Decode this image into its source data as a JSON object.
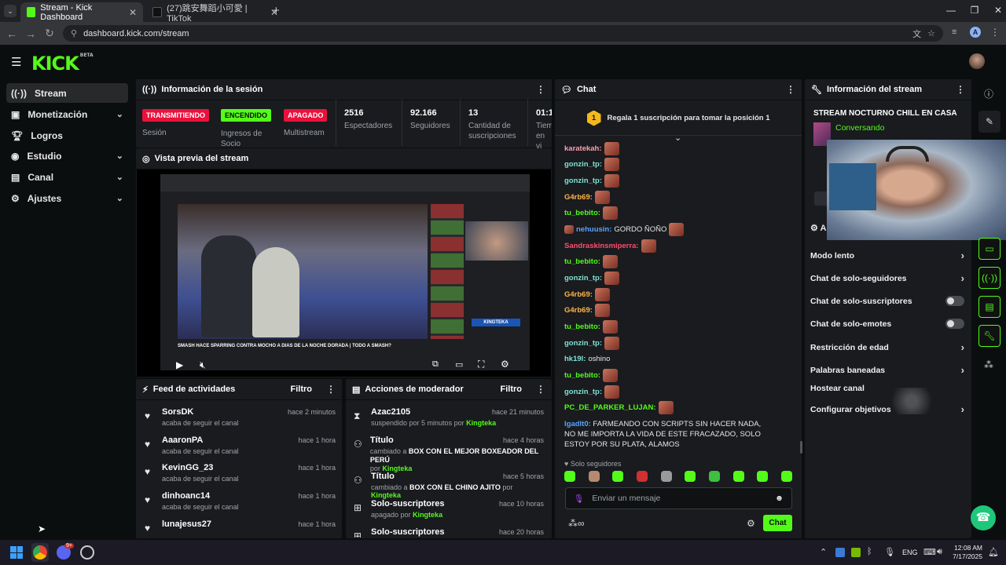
{
  "browser": {
    "tabs": [
      {
        "title": "Stream - Kick Dashboard",
        "active": true
      },
      {
        "title": "(27)跳安舞蹈小可愛 | TikTok",
        "active": false
      }
    ],
    "url": "dashboard.kick.com/stream",
    "profile_initial": "A"
  },
  "app": {
    "logo": "KICK",
    "logo_tag": "BETA"
  },
  "sidebar": {
    "items": [
      {
        "label": "Stream",
        "icon": "stream-icon"
      },
      {
        "label": "Monetización",
        "icon": "money-icon"
      },
      {
        "label": "Logros",
        "icon": "trophy-icon"
      },
      {
        "label": "Estudio",
        "icon": "studio-icon"
      },
      {
        "label": "Canal",
        "icon": "channel-icon"
      },
      {
        "label": "Ajustes",
        "icon": "gear-icon"
      }
    ]
  },
  "session": {
    "title": "Información de la sesión",
    "badges": [
      {
        "label": "TRANSMITIENDO",
        "caption": "Sesión",
        "color": "#e9113c"
      },
      {
        "label": "ENCENDIDO",
        "caption": "Ingresos de Socio",
        "color": "#53fc18"
      },
      {
        "label": "APAGADO",
        "caption": "Multistream",
        "color": "#e9113c"
      }
    ],
    "stats": [
      {
        "value": "2516",
        "label": "Espectadores"
      },
      {
        "value": "92.166",
        "label": "Seguidores"
      },
      {
        "value": "13",
        "label": "Cantidad de suscripciones"
      },
      {
        "value": "01:1",
        "label": "Tiem en vi"
      }
    ]
  },
  "preview": {
    "title": "Vista previa del stream",
    "video_caption": "SMASH HACE SPARRING CONTRA MOCHO A DIAS DE LA NOCHE DORADA | TODO A SMASH?",
    "overlay_name": "KINGTEKA"
  },
  "activity": {
    "title": "Feed de actividades",
    "filter": "Filtro",
    "items": [
      {
        "name": "SorsDK",
        "action": "acaba de seguir el canal",
        "time": "hace 2 minutos"
      },
      {
        "name": "AaaronPA",
        "action": "acaba de seguir el canal",
        "time": "hace 1 hora"
      },
      {
        "name": "KevinGG_23",
        "action": "acaba de seguir el canal",
        "time": "hace 1 hora"
      },
      {
        "name": "dinhoanc14",
        "action": "acaba de seguir el canal",
        "time": "hace 1 hora"
      },
      {
        "name": "lunajesus27",
        "action": "",
        "time": "hace 1 hora"
      }
    ]
  },
  "modactions": {
    "title": "Acciones de moderador",
    "filter": "Filtro",
    "items": [
      {
        "name": "Azac2105",
        "pre": "suspendido por 5 minutos por",
        "target": "",
        "by": "Kingteka",
        "time": "hace 21 minutos",
        "icon": "hourglass-icon"
      },
      {
        "name": "Título",
        "pre": "cambiado a",
        "target": "BOX CON EL MEJOR BOXEADOR DEL PERÚ",
        "by": "Kingteka",
        "time": "hace 4 horas",
        "icon": "title-icon"
      },
      {
        "name": "Título",
        "pre": "cambiado a",
        "target": "BOX CON EL CHINO AJITO",
        "by": "Kingteka",
        "time": "hace 5 horas",
        "icon": "title-icon"
      },
      {
        "name": "Solo-suscriptores",
        "pre": "apagado por",
        "target": "",
        "by": "Kingteka",
        "time": "hace 10 horas",
        "icon": "gift-icon"
      },
      {
        "name": "Solo-suscriptores",
        "pre": "",
        "target": "",
        "by": "",
        "time": "hace 20 horas",
        "icon": "gift-icon"
      }
    ]
  },
  "chat": {
    "title": "Chat",
    "gift_position": "1",
    "gift_text": "Regala 1 suscripción para tomar la posición 1",
    "messages": [
      {
        "user": "karatekah:",
        "color": "#ff9fb0",
        "text": "",
        "emote": true
      },
      {
        "user": "gonzin_tp:",
        "color": "#7fe3d4",
        "text": "",
        "emote": true
      },
      {
        "user": "gonzin_tp:",
        "color": "#7fe3d4",
        "text": "",
        "emote": true
      },
      {
        "user": "G4rb69:",
        "color": "#ffb347",
        "text": "",
        "emote": true
      },
      {
        "user": "tu_bebito:",
        "color": "#53fc18",
        "text": "",
        "emote": true
      },
      {
        "user": "nehuusin:",
        "color": "#5aa2ff",
        "text": "GORDO ÑOÑO",
        "emote": true
      },
      {
        "user": "Sandraskinsmiperra:",
        "color": "#ff4d6d",
        "text": "",
        "emote": true
      },
      {
        "user": "tu_bebito:",
        "color": "#53fc18",
        "text": "",
        "emote": true
      },
      {
        "user": "gonzin_tp:",
        "color": "#7fe3d4",
        "text": "",
        "emote": true
      },
      {
        "user": "G4rb69:",
        "color": "#ffb347",
        "text": "",
        "emote": true
      },
      {
        "user": "G4rb69:",
        "color": "#ffb347",
        "text": "",
        "emote": true
      },
      {
        "user": "tu_bebito:",
        "color": "#53fc18",
        "text": "",
        "emote": true
      },
      {
        "user": "gonzin_tp:",
        "color": "#7fe3d4",
        "text": "",
        "emote": true
      },
      {
        "user": "hk19l:",
        "color": "#7fe3d4",
        "text": "oshino",
        "emote": false
      },
      {
        "user": "tu_bebito:",
        "color": "#53fc18",
        "text": "",
        "emote": true
      },
      {
        "user": "gonzin_tp:",
        "color": "#7fe3d4",
        "text": "",
        "emote": true
      },
      {
        "user": "PC_DE_PARKER_LUJAN:",
        "color": "#53fc18",
        "text": "",
        "emote": true
      }
    ],
    "long_message": {
      "user": "lgadlt0:",
      "color": "#5aa2ff",
      "text": "FARMEANDO CON SCRIPTS SIN HACER NADA, NO ME IMPORTA LA VIDA DE ESTE FRACAZADO, SOLO ESTOY POR SU PLATA, ALAMOS"
    },
    "mode_label": "Solo seguidores",
    "input_placeholder": "Enviar un mensaje",
    "send_label": "Chat"
  },
  "streaminfo": {
    "title": "Información del stream",
    "stream_title": "STREAM NOCTURNO CHILL EN CASA",
    "category": "Conversando",
    "settings_header": "A",
    "settings": [
      {
        "label": "Modo lento",
        "control": "arrow"
      },
      {
        "label": "Chat de solo-seguidores",
        "control": "arrow"
      },
      {
        "label": "Chat de solo-suscriptores",
        "control": "toggle"
      },
      {
        "label": "Chat de solo-emotes",
        "control": "toggle"
      },
      {
        "label": "Restricción de edad",
        "control": "arrow"
      },
      {
        "label": "Palabras baneadas",
        "control": "arrow"
      },
      {
        "label": "Hostear canal",
        "control": "none"
      },
      {
        "label": "Configurar objetivos",
        "control": "arrow"
      }
    ]
  },
  "taskbar": {
    "lang": "ENG",
    "time": "12:08 AM",
    "date": "7/17/2025",
    "badge": "9+"
  },
  "colors": {
    "accent": "#53fc18",
    "live": "#e9113c",
    "bg": "#0b0e0f",
    "panel": "#191b1f"
  }
}
